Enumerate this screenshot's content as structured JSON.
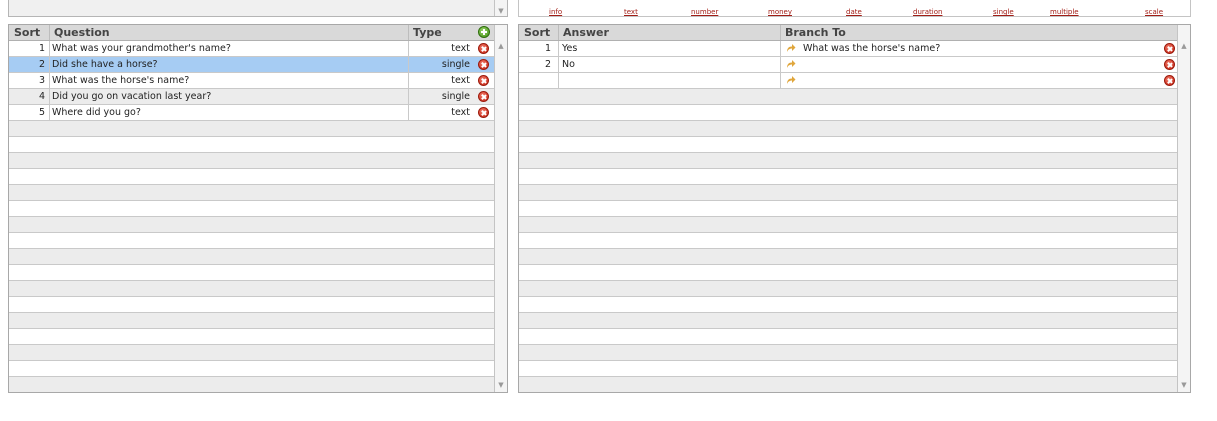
{
  "questions": {
    "headers": {
      "sort": "Sort",
      "question": "Question",
      "type": "Type"
    },
    "rows": [
      {
        "sort": "1",
        "question": "What was your grandmother's name?",
        "type": "text"
      },
      {
        "sort": "2",
        "question": "Did she have a horse?",
        "type": "single",
        "selected": true
      },
      {
        "sort": "3",
        "question": "What was the horse's name?",
        "type": "text"
      },
      {
        "sort": "4",
        "question": "Did you go on vacation last year?",
        "type": "single"
      },
      {
        "sort": "5",
        "question": "Where did you go?",
        "type": "text"
      }
    ]
  },
  "answer_types": [
    "info",
    "text",
    "number",
    "money",
    "date",
    "duration",
    "single",
    "multiple",
    "scale"
  ],
  "answers": {
    "headers": {
      "sort": "Sort",
      "answer": "Answer",
      "branch": "Branch To"
    },
    "rows": [
      {
        "sort": "1",
        "answer": "Yes",
        "branch": "What was the horse's name?"
      },
      {
        "sort": "2",
        "answer": "No",
        "branch": ""
      },
      {
        "sort": "",
        "answer": "",
        "branch": ""
      }
    ]
  },
  "colors": {
    "selected_row": "#a6ccf3",
    "link": "#a21d16",
    "delete": "#c4200e",
    "add": "#3f8f14",
    "branch_arrow": "#e0a63c"
  },
  "icons": {
    "add": "add-icon",
    "delete": "delete-icon",
    "branch": "branch-arrow-icon",
    "scroll_up": "scroll-up-icon",
    "scroll_down": "scroll-down-icon"
  }
}
